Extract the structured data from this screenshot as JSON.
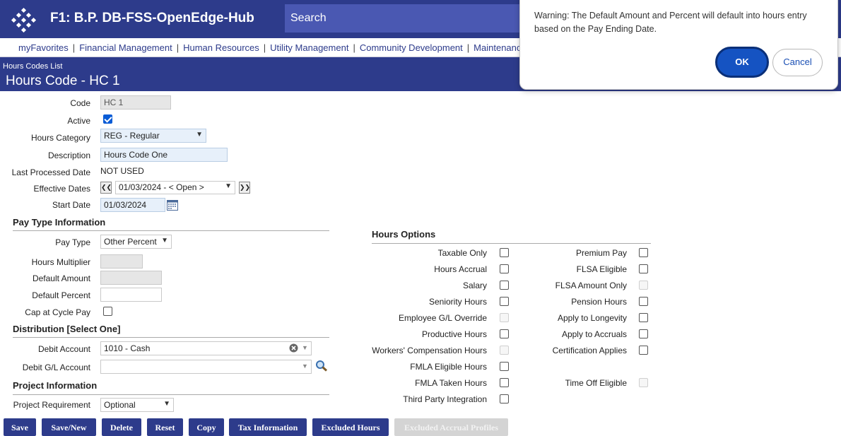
{
  "app": {
    "title": "F1: B.P. DB-FSS-OpenEdge-Hub",
    "search_placeholder": "Search"
  },
  "menu": {
    "items": [
      "myFavorites",
      "Financial Management",
      "Human Resources",
      "Utility Management",
      "Community Development",
      "Maintenanc"
    ]
  },
  "header": {
    "breadcrumb": "Hours Codes List",
    "title": "Hours Code - HC 1"
  },
  "form": {
    "code_label": "Code",
    "code_value": "HC 1",
    "active_label": "Active",
    "hours_category_label": "Hours Category",
    "hours_category_value": "REG - Regular",
    "description_label": "Description",
    "description_value": "Hours Code One",
    "last_processed_label": "Last Processed Date",
    "last_processed_value": "NOT USED",
    "effective_dates_label": "Effective Dates",
    "effective_dates_value": "01/03/2024 - < Open >",
    "start_date_label": "Start Date",
    "start_date_value": "01/03/2024"
  },
  "pay_type": {
    "section_title": "Pay Type Information",
    "pay_type_label": "Pay Type",
    "pay_type_value": "Other Percent",
    "hours_multiplier_label": "Hours Multiplier",
    "default_amount_label": "Default Amount",
    "default_percent_label": "Default Percent",
    "cap_label": "Cap at Cycle Pay"
  },
  "distribution": {
    "section_title": "Distribution [Select One]",
    "debit_account_label": "Debit Account",
    "debit_account_value": "1010 - Cash",
    "debit_gl_label": "Debit G/L Account"
  },
  "project": {
    "section_title": "Project Information",
    "requirement_label": "Project Requirement",
    "requirement_value": "Optional"
  },
  "hours_options": {
    "section_title": "Hours Options",
    "left": [
      {
        "label": "Taxable Only",
        "disabled": false
      },
      {
        "label": "Hours Accrual",
        "disabled": false
      },
      {
        "label": "Salary",
        "disabled": false
      },
      {
        "label": "Seniority Hours",
        "disabled": false
      },
      {
        "label": "Employee G/L Override",
        "disabled": true
      },
      {
        "label": "Productive Hours",
        "disabled": false
      },
      {
        "label": "Workers' Compensation Hours",
        "disabled": true
      },
      {
        "label": "FMLA Eligible Hours",
        "disabled": false
      },
      {
        "label": "FMLA Taken Hours",
        "disabled": false
      },
      {
        "label": "Third Party Integration",
        "disabled": false
      }
    ],
    "right": [
      {
        "label": "Premium Pay",
        "disabled": false
      },
      {
        "label": "FLSA Eligible",
        "disabled": false
      },
      {
        "label": "FLSA Amount Only",
        "disabled": true
      },
      {
        "label": "Pension Hours",
        "disabled": false
      },
      {
        "label": "Apply to Longevity",
        "disabled": false
      },
      {
        "label": "Apply to Accruals",
        "disabled": false
      },
      {
        "label": "Certification Applies",
        "disabled": false
      },
      {
        "label": "Time Off Eligible",
        "disabled": true
      }
    ]
  },
  "buttons": {
    "save": "Save",
    "save_new": "Save/New",
    "delete": "Delete",
    "reset": "Reset",
    "copy": "Copy",
    "tax_information": "Tax Information",
    "excluded_hours": "Excluded Hours",
    "excluded_accrual_profiles": "Excluded Accrual Profiles"
  },
  "modal": {
    "message": "Warning: The Default Amount and Percent will default into hours entry based on the Pay Ending Date.",
    "ok": "OK",
    "cancel": "Cancel"
  }
}
